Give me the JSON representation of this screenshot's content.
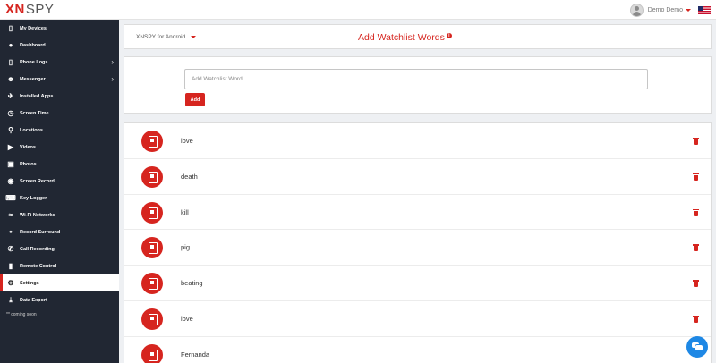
{
  "header": {
    "logo_x": "XN",
    "logo_spy": "SPY",
    "username": "Demo Demo",
    "flag_icon": "us-flag-icon"
  },
  "sidebar": {
    "items": [
      {
        "label": "My Devices",
        "icon": "phone-icon",
        "has_submenu": false
      },
      {
        "label": "Dashboard",
        "icon": "dashboard-icon",
        "has_submenu": false
      },
      {
        "label": "Phone Logs",
        "icon": "phone-icon",
        "has_submenu": true
      },
      {
        "label": "Messenger",
        "icon": "users-icon",
        "has_submenu": true
      },
      {
        "label": "Installed Apps",
        "icon": "plane-icon",
        "has_submenu": false
      },
      {
        "label": "Screen Time",
        "icon": "clock-icon",
        "has_submenu": false
      },
      {
        "label": "Locations",
        "icon": "map-pin-icon",
        "has_submenu": false
      },
      {
        "label": "Videos",
        "icon": "video-icon",
        "has_submenu": false
      },
      {
        "label": "Photos",
        "icon": "camera-icon",
        "has_submenu": false
      },
      {
        "label": "Screen Record",
        "icon": "record-icon",
        "has_submenu": false
      },
      {
        "label": "Key Logger",
        "icon": "keyboard-icon",
        "has_submenu": false
      },
      {
        "label": "Wi-Fi Networks",
        "icon": "wifi-icon",
        "has_submenu": false
      },
      {
        "label": "Record Surround",
        "icon": "microphone-icon",
        "has_submenu": false
      },
      {
        "label": "Call Recording",
        "icon": "phone-call-icon",
        "has_submenu": false
      },
      {
        "label": "Remote Control",
        "icon": "remote-icon",
        "has_submenu": false
      },
      {
        "label": "Settings",
        "icon": "gear-icon",
        "has_submenu": false,
        "active": true
      },
      {
        "label": "Data Export",
        "icon": "download-icon",
        "has_submenu": false
      }
    ],
    "note": "** coming soon"
  },
  "main": {
    "device_selector": "XNSPY for Android",
    "title": "Add Watchlist Words",
    "input_placeholder": "Add Watchlist Word",
    "add_label": "Add",
    "words": [
      "love",
      "death",
      "kill",
      "pig",
      "beating",
      "love",
      "Fernanda"
    ]
  },
  "colors": {
    "accent": "#d6251f",
    "sidebar_bg": "#212733",
    "chat": "#1e88e5"
  }
}
